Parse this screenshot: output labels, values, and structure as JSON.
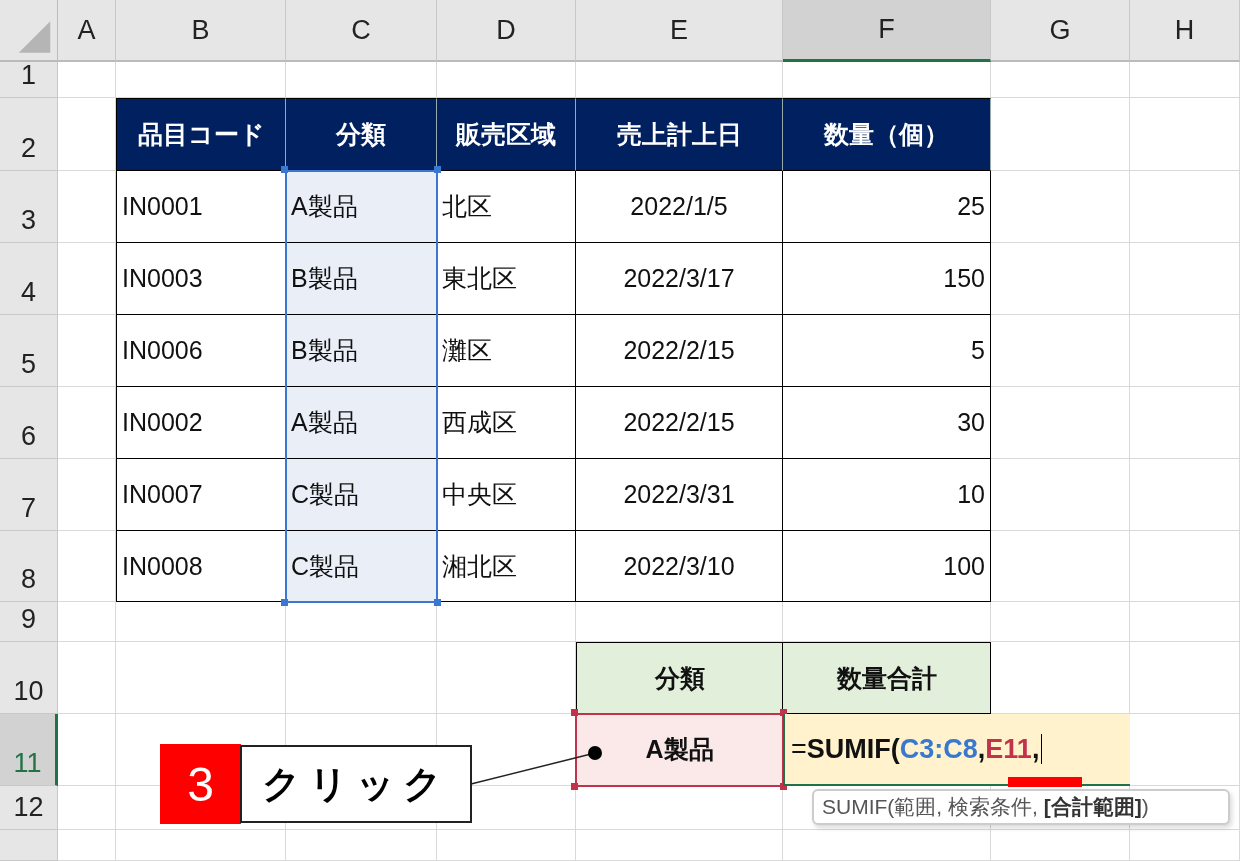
{
  "columns": [
    {
      "label": "A",
      "selected": false
    },
    {
      "label": "B",
      "selected": false
    },
    {
      "label": "C",
      "selected": false
    },
    {
      "label": "D",
      "selected": false
    },
    {
      "label": "E",
      "selected": false
    },
    {
      "label": "F",
      "selected": true
    },
    {
      "label": "G",
      "selected": false
    },
    {
      "label": "H",
      "selected": false
    }
  ],
  "rows": [
    {
      "label": "1",
      "selected": false
    },
    {
      "label": "2",
      "selected": false
    },
    {
      "label": "3",
      "selected": false
    },
    {
      "label": "4",
      "selected": false
    },
    {
      "label": "5",
      "selected": false
    },
    {
      "label": "6",
      "selected": false
    },
    {
      "label": "7",
      "selected": false
    },
    {
      "label": "8",
      "selected": false
    },
    {
      "label": "9",
      "selected": false
    },
    {
      "label": "10",
      "selected": false
    },
    {
      "label": "11",
      "selected": true
    },
    {
      "label": "12",
      "selected": false
    }
  ],
  "table": {
    "columns": [
      "品目コード",
      "分類",
      "販売区域",
      "売上計上日",
      "数量（個）"
    ],
    "rows": [
      [
        "IN0001",
        "A製品",
        "北区",
        "2022/1/5",
        "25"
      ],
      [
        "IN0003",
        "B製品",
        "東北区",
        "2022/3/17",
        "150"
      ],
      [
        "IN0006",
        "B製品",
        "灘区",
        "2022/2/15",
        "5"
      ],
      [
        "IN0002",
        "A製品",
        "西成区",
        "2022/2/15",
        "30"
      ],
      [
        "IN0007",
        "C製品",
        "中央区",
        "2022/3/31",
        "10"
      ],
      [
        "IN0008",
        "C製品",
        "湘北区",
        "2022/3/10",
        "100"
      ]
    ]
  },
  "summary": {
    "columns": [
      "分類",
      "数量合計"
    ],
    "criteria": "A製品",
    "formula": [
      {
        "kind": "plain",
        "text": "="
      },
      {
        "kind": "function",
        "text": "SUMIF("
      },
      {
        "kind": "ref",
        "text": "C3:C8",
        "color": "#3a78d0"
      },
      {
        "kind": "function",
        "text": ","
      },
      {
        "kind": "ref",
        "text": "E11",
        "color": "#c0334a"
      },
      {
        "kind": "function",
        "text": ","
      }
    ]
  },
  "tooltip": "SUMIF(範囲, 検索条件, **[合計範囲]**)",
  "callout": {
    "step": "3",
    "label": "クリック"
  }
}
